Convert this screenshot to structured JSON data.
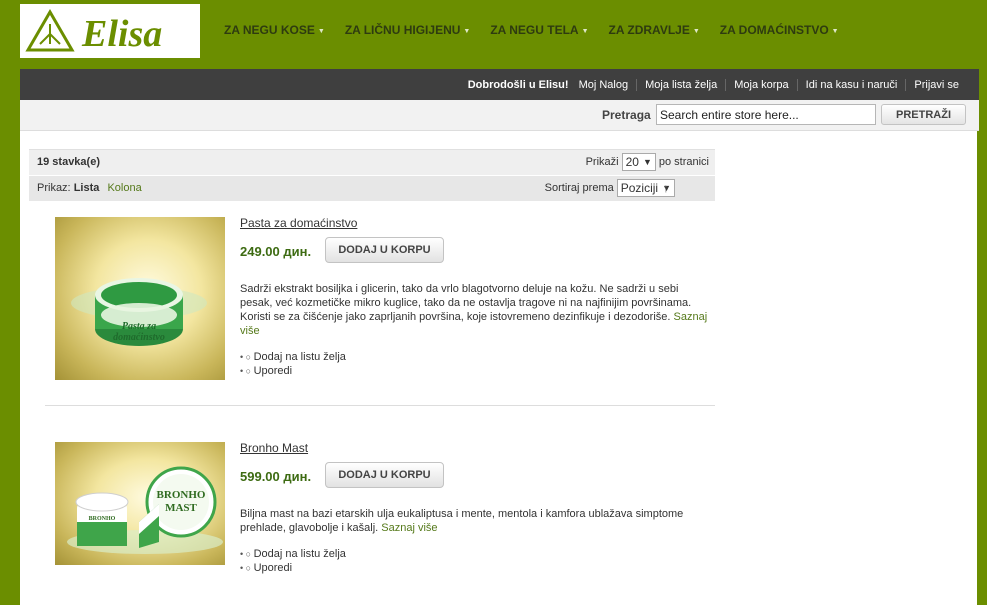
{
  "brand": {
    "logo_text": "Elisa",
    "color": "#6b8e00"
  },
  "nav": [
    {
      "label": "ZA NEGU KOSE"
    },
    {
      "label": "ZA LIČNU HIGIJENU"
    },
    {
      "label": "ZA NEGU TELA"
    },
    {
      "label": "ZA ZDRAVLJE"
    },
    {
      "label": "ZA DOMAĆINSTVO"
    }
  ],
  "toplinks": {
    "welcome": "Dobrodošli u Elisu!",
    "account": "Moj Nalog",
    "wishlist": "Moja lista želja",
    "cart": "Moja korpa",
    "checkout": "Idi na kasu i naruči",
    "login": "Prijavi se"
  },
  "search": {
    "label": "Pretraga",
    "placeholder": "Search entire store here...",
    "button": "PRETRAŽI"
  },
  "toolbar": {
    "count": "19 stavka(e)",
    "show_label": "Prikaži",
    "show_value": "20",
    "per_page": "po stranici",
    "view_label": "Prikaz:",
    "view_list": "Lista",
    "view_grid": "Kolona",
    "sort_label": "Sortiraj prema",
    "sort_value": "Poziciji",
    "sort_dir": "↑"
  },
  "products": [
    {
      "name": "Pasta za domaćinstvo",
      "price": "249.00 дин.",
      "button": "DODAJ U KORPU",
      "description": "Sadrži ekstrakt bosiljka i glicerin, tako da vrlo blagotvorno deluje na kožu. Ne sadrži u sebi pesak, već kozmetičke mikro kuglice, tako da ne ostavlja tragove ni na najfinijim površinama. Koristi se za čišćenje jako zaprljanih površina, koje istovremeno dezinfikuje i dezodoriše.",
      "more": "Saznaj više",
      "jar_label_1": "Pasta za",
      "jar_label_2": "domaćinstvo",
      "wishlist": "Dodaj na listu želja",
      "compare": "Uporedi"
    },
    {
      "name": "Bronho Mast",
      "price": "599.00 дин.",
      "button": "DODAJ U KORPU",
      "description": "Biljna mast na bazi etarskih ulja eukaliptusa i mente, mentola i kamfora ublažava simptome prehlade, glavobolje i kašalj.",
      "more": "Saznaj više",
      "jar_label_1": "BRONHO",
      "jar_label_2": "MAST",
      "wishlist": "Dodaj na listu želja",
      "compare": "Uporedi"
    }
  ]
}
